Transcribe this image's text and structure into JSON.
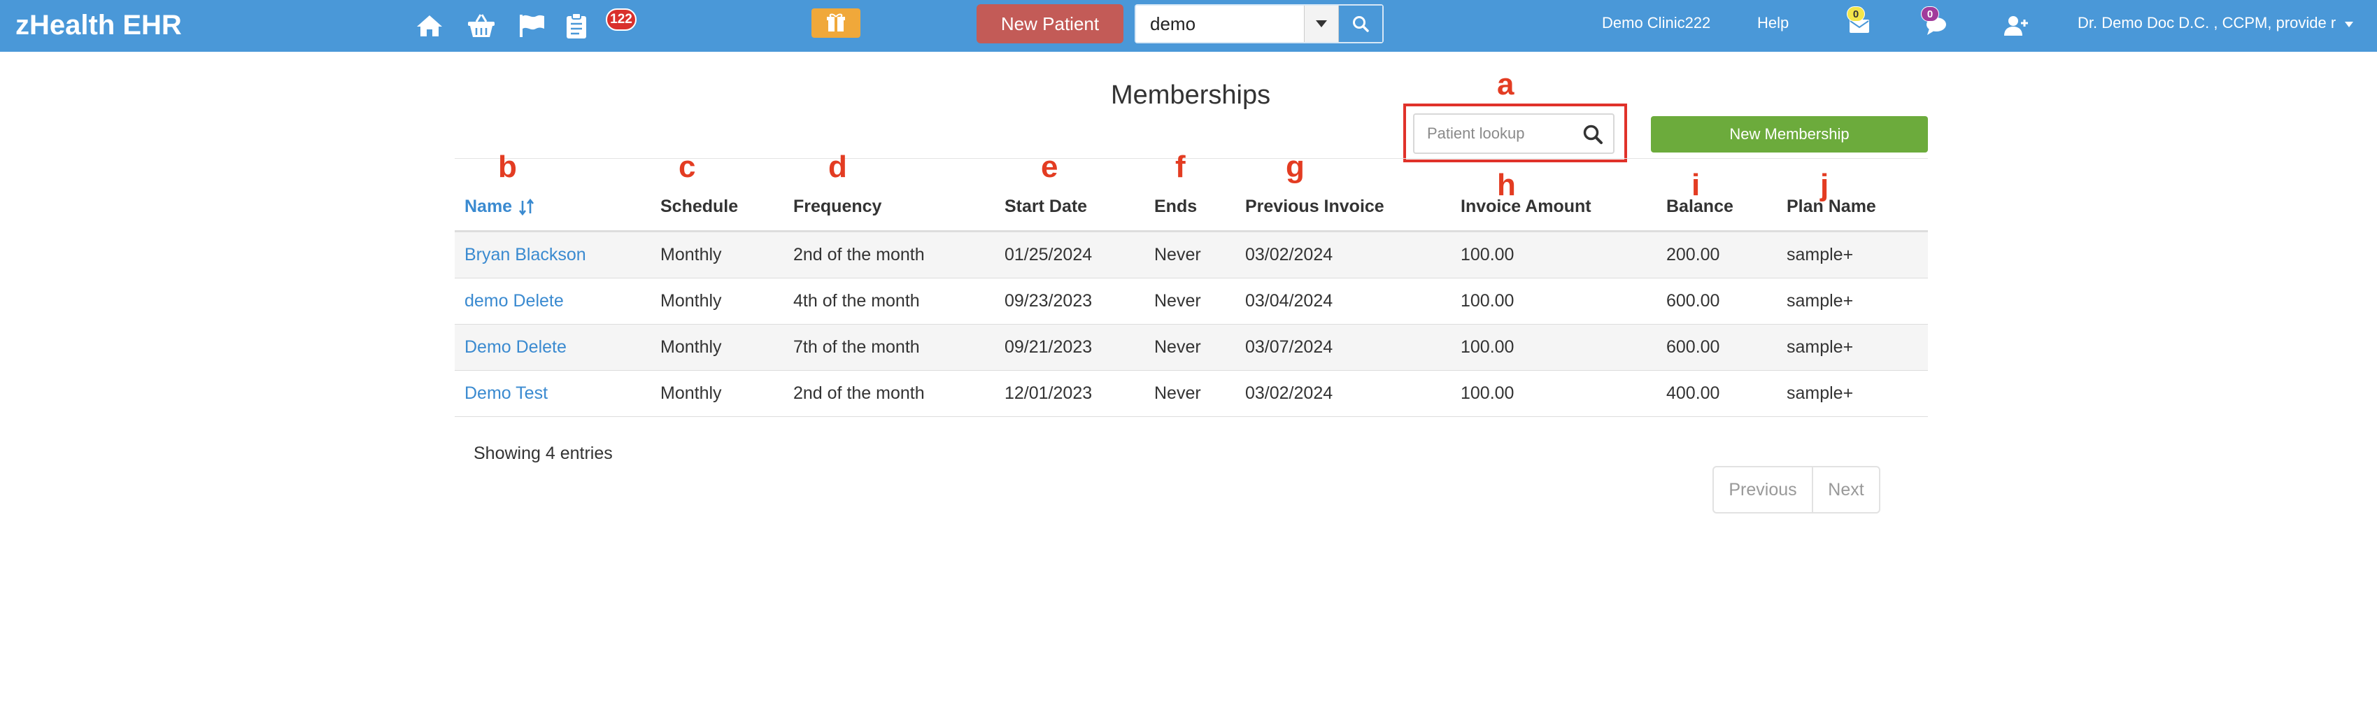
{
  "navbar": {
    "brand": "zHealth EHR",
    "notification_count": "122",
    "new_patient_label": "New Patient",
    "search_value": "demo",
    "clinic": "Demo Clinic222",
    "help": "Help",
    "mail_count": "0",
    "chat_count": "0",
    "user": "Dr. Demo Doc D.C. , CCPM, provide r",
    "colors": {
      "bar": "#4a98d8",
      "new_patient": "#c35b57"
    }
  },
  "page": {
    "title": "Memberships",
    "lookup_placeholder": "Patient lookup",
    "new_membership_label": "New Membership",
    "new_membership_color": "#6cab3c"
  },
  "annotations": {
    "a": "a",
    "b": "b",
    "c": "c",
    "d": "d",
    "e": "e",
    "f": "f",
    "g": "g",
    "h": "h",
    "i": "i",
    "j": "j"
  },
  "table": {
    "columns": [
      "Name",
      "Schedule",
      "Frequency",
      "Start Date",
      "Ends",
      "Previous Invoice",
      "Invoice Amount",
      "Balance",
      "Plan Name"
    ],
    "rows": [
      [
        "Bryan Blackson",
        "Monthly",
        "2nd of the month",
        "01/25/2024",
        "Never",
        "03/02/2024",
        "100.00",
        "200.00",
        "sample+"
      ],
      [
        "demo Delete",
        "Monthly",
        "4th of the month",
        "09/23/2023",
        "Never",
        "03/04/2024",
        "100.00",
        "600.00",
        "sample+"
      ],
      [
        "Demo Delete",
        "Monthly",
        "7th of the month",
        "09/21/2023",
        "Never",
        "03/07/2024",
        "100.00",
        "600.00",
        "sample+"
      ],
      [
        "Demo Test",
        "Monthly",
        "2nd of the month",
        "12/01/2023",
        "Never",
        "03/02/2024",
        "100.00",
        "400.00",
        "sample+"
      ]
    ]
  },
  "footer": {
    "entries_info": "Showing 4 entries",
    "previous": "Previous",
    "next": "Next"
  }
}
